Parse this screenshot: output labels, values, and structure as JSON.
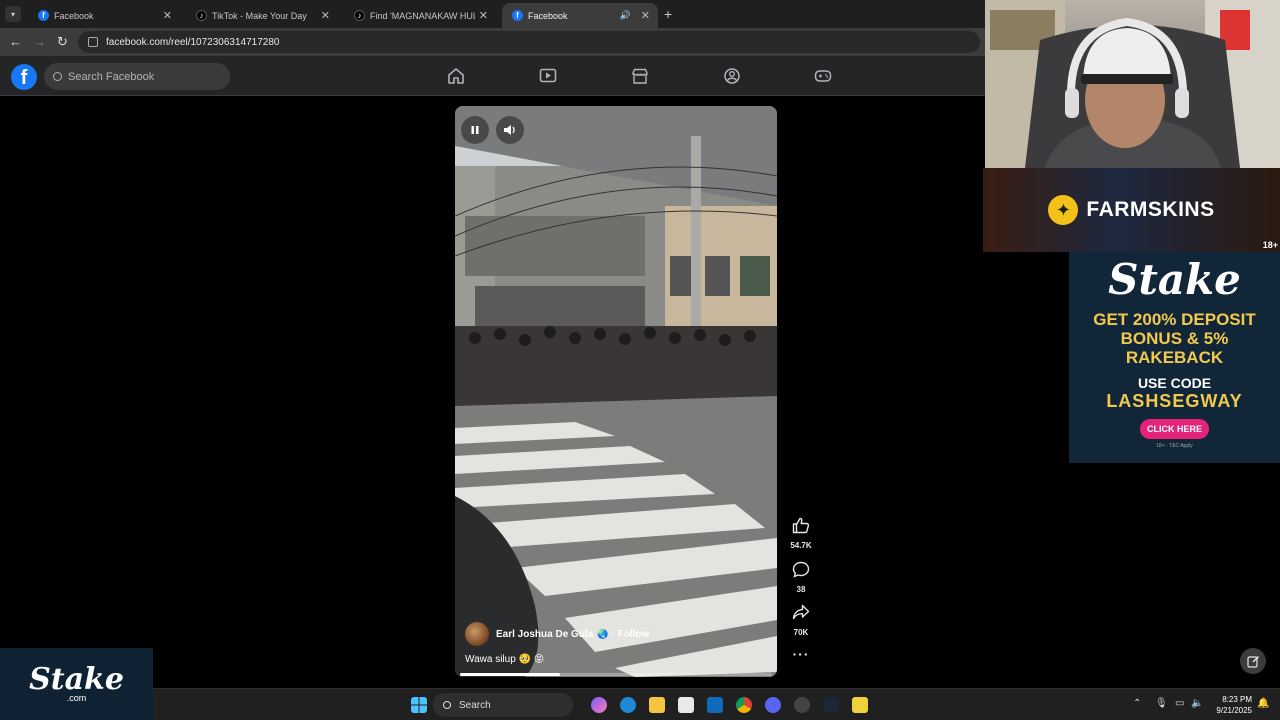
{
  "browser": {
    "tabs": [
      {
        "title": "Facebook",
        "favicon": "facebook-icon",
        "active": false
      },
      {
        "title": "TikTok - Make Your Day",
        "favicon": "tiktok-icon",
        "active": false
      },
      {
        "title": "Find 'MAGNANAKAW HULI' on",
        "favicon": "tiktok-icon",
        "active": false
      },
      {
        "title": "Facebook",
        "favicon": "facebook-icon",
        "active": true
      }
    ],
    "url": "facebook.com/reel/1072306314717280"
  },
  "facebook": {
    "search_placeholder": "Search Facebook",
    "nav_icons": [
      "home-icon",
      "video-icon",
      "marketplace-icon",
      "groups-icon",
      "gaming-icon"
    ],
    "brand_color": "#1877f2"
  },
  "reel": {
    "author": "Earl Joshua De Gula",
    "follow_label": "· Follow",
    "caption": "Wawa silup 🥺 😝",
    "progress": 0.32,
    "actions": {
      "likes": "54.7K",
      "comments": "38",
      "shares": "70K"
    }
  },
  "overlays": {
    "farmskins": {
      "name": "FARMSKINS",
      "age": "18+"
    },
    "stake_ad": {
      "brand": "Stake",
      "offer_lines": [
        "GET 200% DEPOSIT",
        "BONUS & 5%",
        "RAKEBACK"
      ],
      "use_code": "USE CODE",
      "code": "LASHSEGWAY",
      "cta": "CLICK HERE",
      "fine_print": "18+ · T&C Apply"
    },
    "stake_corner": {
      "brand": "Stake",
      "tld": ".com"
    }
  },
  "taskbar": {
    "search_label": "Search",
    "time": "8:23 PM",
    "date": "9/21/2025"
  }
}
